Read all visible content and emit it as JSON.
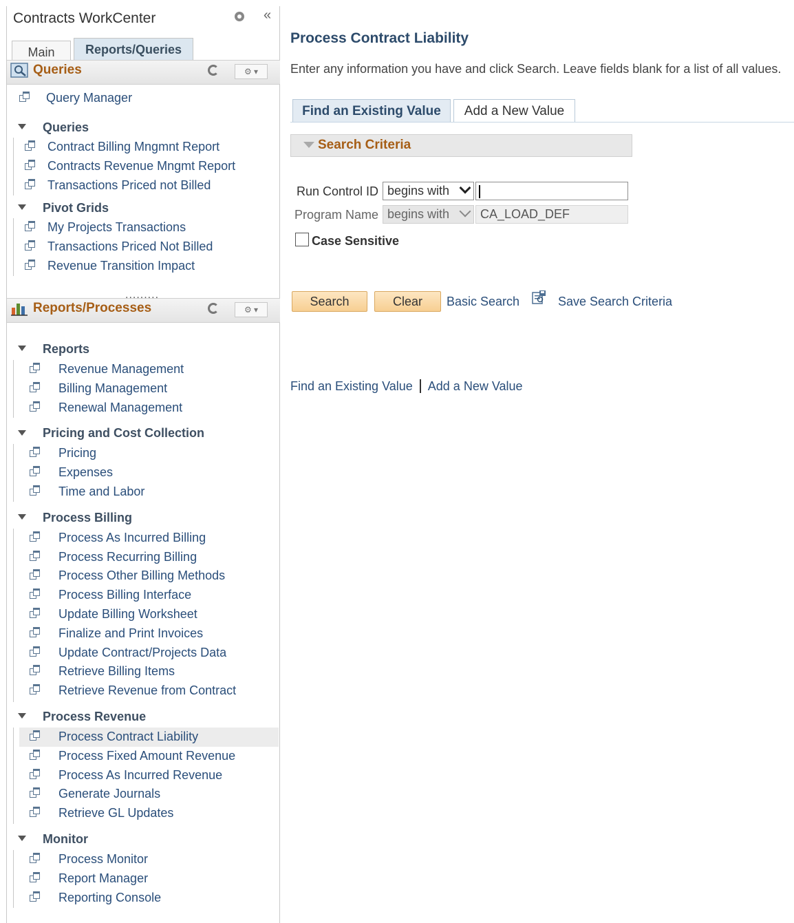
{
  "workcenter": {
    "title": "Contracts WorkCenter",
    "tabs": {
      "main": "Main",
      "reports": "Reports/Queries"
    }
  },
  "queries_pagelet": {
    "title": "Queries",
    "top_links": [
      "Query Manager"
    ],
    "groups": [
      {
        "label": "Queries",
        "items": [
          "Contract Billing Mngmnt Report",
          "Contracts Revenue Mngmt Report",
          "Transactions Priced not Billed"
        ]
      },
      {
        "label": "Pivot Grids",
        "items": [
          "My Projects Transactions",
          "Transactions Priced Not Billed",
          "Revenue Transition Impact"
        ]
      }
    ]
  },
  "splitter": ".........",
  "reports_pagelet": {
    "title": "Reports/Processes",
    "groups": [
      {
        "label": "Reports",
        "items": [
          "Revenue Management",
          "Billing Management",
          "Renewal Management"
        ]
      },
      {
        "label": "Pricing and Cost Collection",
        "items": [
          "Pricing",
          "Expenses",
          "Time and Labor"
        ]
      },
      {
        "label": "Process Billing",
        "items": [
          "Process As Incurred Billing",
          "Process Recurring Billing",
          "Process Other Billing Methods",
          "Process Billing Interface",
          "Update Billing Worksheet",
          "Finalize and Print Invoices",
          "Update Contract/Projects Data",
          "Retrieve Billing Items",
          "Retrieve Revenue from Contract"
        ]
      },
      {
        "label": "Process Revenue",
        "items": [
          "Process Contract Liability",
          "Process Fixed Amount Revenue",
          "Process As Incurred Revenue",
          "Generate Journals",
          "Retrieve GL Updates"
        ]
      },
      {
        "label": "Monitor",
        "items": [
          "Process Monitor",
          "Report Manager",
          "Reporting Console"
        ]
      }
    ],
    "selected_item": "Process Contract Liability"
  },
  "main": {
    "title": "Process Contract Liability",
    "instructions": "Enter any information you have and click Search. Leave fields blank for a list of all values.",
    "tabs": {
      "find": "Find an Existing Value",
      "add": "Add a New Value"
    },
    "section_title": "Search Criteria",
    "fields": {
      "run_control": {
        "label": "Run Control ID",
        "operator": "begins with",
        "value": ""
      },
      "program_name": {
        "label": "Program Name",
        "operator": "begins with",
        "value": "CA_LOAD_DEF"
      }
    },
    "case_sensitive_label": "Case Sensitive",
    "buttons": {
      "search": "Search",
      "clear": "Clear"
    },
    "basic_search": "Basic Search",
    "save_search": "Save Search Criteria",
    "bottom_links": {
      "find": "Find an Existing Value",
      "add": "Add a New Value"
    }
  },
  "colors": {
    "pagelet_title": "#a65e16",
    "link": "#2a4e7a",
    "page_title": "#2d4b6b",
    "button_bg": "#f7cf92"
  }
}
